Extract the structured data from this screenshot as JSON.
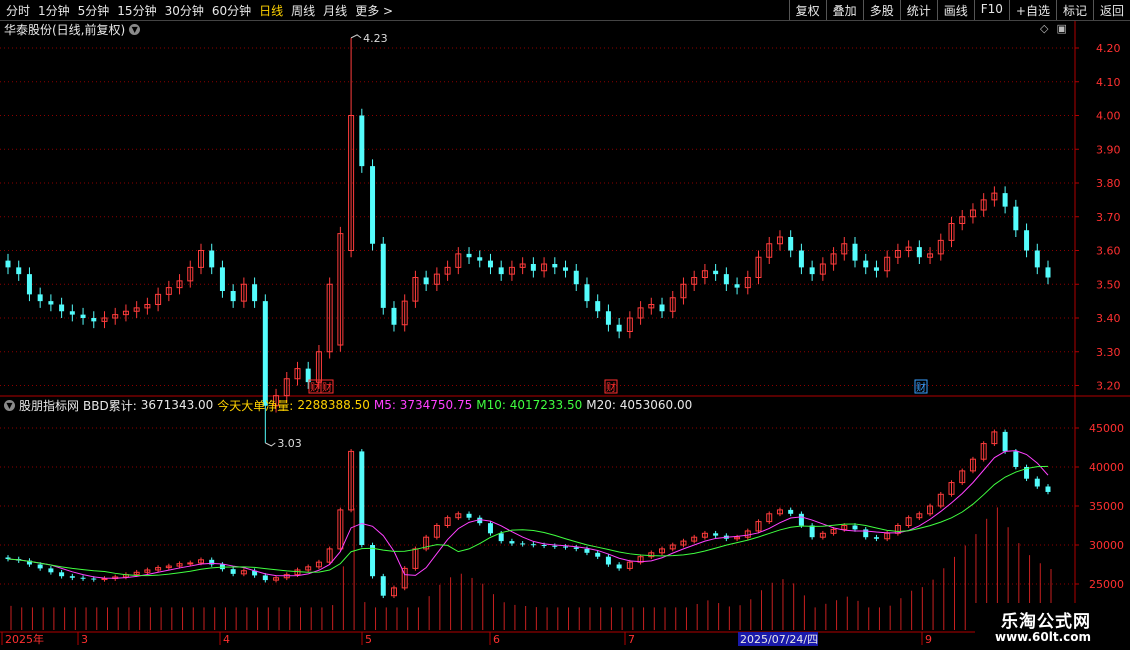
{
  "toolbar": {
    "left": [
      "分时",
      "1分钟",
      "5分钟",
      "15分钟",
      "30分钟",
      "60分钟",
      "日线",
      "周线",
      "月线",
      "更多 >"
    ],
    "active_index": 6,
    "right": [
      "复权",
      "叠加",
      "多股",
      "统计",
      "画线",
      "F10",
      "+自选",
      "标记",
      "返回"
    ]
  },
  "title": "华泰股份(日线,前复权)",
  "price_axis": [
    "4.20",
    "4.10",
    "4.00",
    "3.90",
    "3.80",
    "3.70",
    "3.60",
    "3.50",
    "3.40",
    "3.30",
    "3.20"
  ],
  "annotations": {
    "high": "4.23",
    "low": "3.03"
  },
  "markers": [
    {
      "text": "财",
      "color": "#ff3030"
    },
    {
      "text": "财",
      "color": "#3aa0ff"
    }
  ],
  "indicator": {
    "name": "股朋指标网",
    "bbd_label": "BBD累计:",
    "bbd_value": "3671343.00",
    "today_label": "今天大单净量:",
    "today_value": "2288388.50",
    "m5": "M5: 3734750.75",
    "m10": "M10: 4017233.50",
    "m20": "M20: 4053060.00",
    "axis": [
      "45000",
      "40000",
      "35000",
      "30000",
      "25000"
    ]
  },
  "date_axis": {
    "labels": [
      "2025年",
      "3",
      "4",
      "5",
      "6",
      "7",
      "9"
    ],
    "highlight": "2025/07/24/四"
  },
  "brand": {
    "name": "乐淘公式网",
    "url": "www.60lt.com"
  },
  "colors": {
    "up": "#ff3c3c",
    "down": "#54fcfc",
    "bg": "#000000",
    "grid": "#8b0000",
    "m5": "#ff40ff",
    "m10": "#40ff40",
    "m20": "#ffffff",
    "accent": "#ffd200"
  },
  "chart_data": {
    "type": "candlestick",
    "title": "华泰股份(日线,前复权)",
    "ylim": [
      3.03,
      4.23
    ],
    "high": 4.23,
    "low": 3.03,
    "closes": [
      3.55,
      3.53,
      3.47,
      3.45,
      3.44,
      3.42,
      3.41,
      3.4,
      3.39,
      3.4,
      3.41,
      3.42,
      3.43,
      3.44,
      3.47,
      3.49,
      3.51,
      3.55,
      3.6,
      3.55,
      3.48,
      3.45,
      3.5,
      3.45,
      3.14,
      3.17,
      3.22,
      3.25,
      3.21,
      3.3,
      3.5,
      3.65,
      4.0,
      3.85,
      3.62,
      3.43,
      3.38,
      3.45,
      3.52,
      3.5,
      3.53,
      3.55,
      3.59,
      3.58,
      3.57,
      3.55,
      3.53,
      3.55,
      3.56,
      3.54,
      3.56,
      3.55,
      3.54,
      3.5,
      3.45,
      3.42,
      3.38,
      3.36,
      3.4,
      3.43,
      3.44,
      3.42,
      3.46,
      3.5,
      3.52,
      3.54,
      3.53,
      3.5,
      3.49,
      3.52,
      3.58,
      3.62,
      3.64,
      3.6,
      3.55,
      3.53,
      3.56,
      3.59,
      3.62,
      3.57,
      3.55,
      3.54,
      3.58,
      3.6,
      3.61,
      3.58,
      3.59,
      3.63,
      3.68,
      3.7,
      3.72,
      3.75,
      3.77,
      3.73,
      3.66,
      3.6,
      3.55,
      3.52
    ],
    "indicator_values": [
      28200,
      28000,
      27500,
      27000,
      26500,
      26000,
      25800,
      25700,
      25600,
      25700,
      25900,
      26200,
      26500,
      26800,
      27100,
      27300,
      27600,
      27700,
      28100,
      27500,
      26900,
      26300,
      26700,
      26100,
      25500,
      25800,
      26200,
      26800,
      27200,
      27800,
      29500,
      34500,
      42000,
      30000,
      26000,
      23500,
      24500,
      27000,
      29500,
      31000,
      32500,
      33500,
      34000,
      33500,
      32800,
      31500,
      30500,
      30200,
      30100,
      30000,
      29900,
      29800,
      29700,
      29500,
      29000,
      28500,
      27500,
      27000,
      27800,
      28500,
      29000,
      29500,
      30000,
      30500,
      31000,
      31500,
      31200,
      30800,
      31000,
      31800,
      33000,
      34000,
      34500,
      34000,
      32500,
      31000,
      31500,
      32000,
      32500,
      32000,
      31000,
      30800,
      31500,
      32500,
      33500,
      34000,
      35000,
      36500,
      38000,
      39500,
      41000,
      43000,
      44500,
      42000,
      40000,
      38500,
      37500,
      36800
    ]
  }
}
